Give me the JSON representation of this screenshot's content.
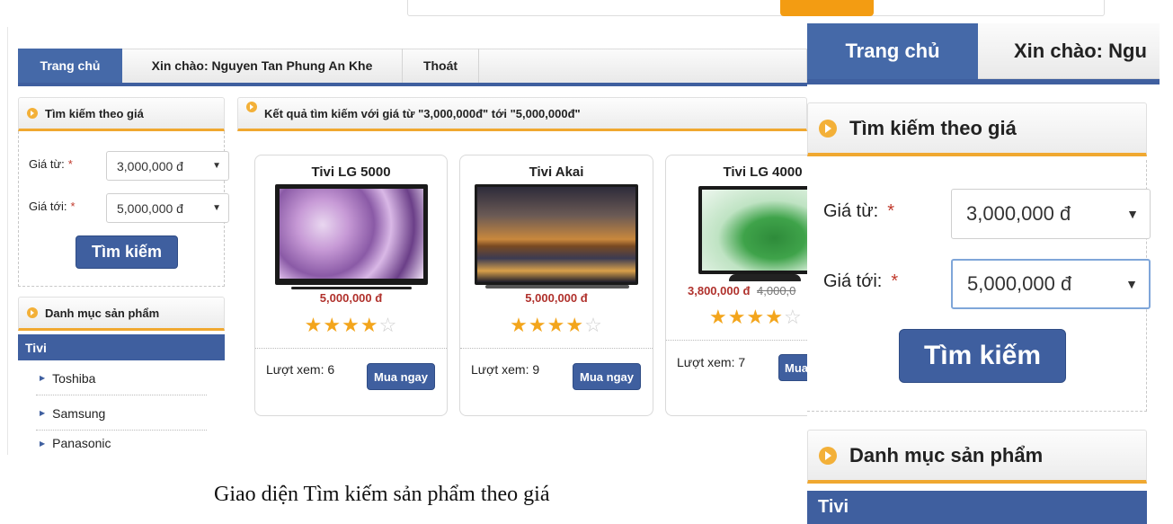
{
  "nav": {
    "home": "Trang chủ",
    "greeting": "Xin chào: Nguyen Tan Phung An Khe",
    "logout": "Thoát"
  },
  "price_search": {
    "header": "Tìm kiếm theo giá",
    "from_label": "Giá từ:",
    "to_label": "Giá tới:",
    "required_mark": "*",
    "from_value": "3,000,000 đ",
    "to_value": "5,000,000 đ",
    "search_button": "Tìm kiếm"
  },
  "category": {
    "header": "Danh mục sản phẩm",
    "active": "Tivi",
    "items": [
      "Toshiba",
      "Samsung",
      "Panasonic"
    ]
  },
  "results": {
    "header": "Kết quả tìm kiếm với giá từ \"3,000,000đ\" tới \"5,000,000đ\"",
    "products": [
      {
        "name": "Tivi LG 5000",
        "price": "5,000,000 đ",
        "old_price": "",
        "rating": 4,
        "views_label": "Lượt xem: 6",
        "buy_label": "Mua ngay"
      },
      {
        "name": "Tivi Akai",
        "price": "5,000,000 đ",
        "old_price": "",
        "rating": 4,
        "views_label": "Lượt xem: 9",
        "buy_label": "Mua ngay"
      },
      {
        "name": "Tivi LG 4000",
        "price": "3,800,000 đ",
        "old_price": "4,000,0",
        "rating": 4,
        "views_label": "Lượt xem: 7",
        "buy_label": "Mua"
      }
    ]
  },
  "zoom": {
    "home": "Trang chủ",
    "greeting": "Xin chào: Ngu",
    "price_header": "Tìm kiếm theo giá",
    "from_label": "Giá từ:",
    "to_label": "Giá tới:",
    "required_mark": "*",
    "from_value": "3,000,000 đ",
    "to_value": "5,000,000 đ",
    "search_button": "Tìm kiếm",
    "category_header": "Danh mục sản phẩm",
    "category_active": "Tivi"
  },
  "caption": "Giao diện Tìm kiếm sản phẩm theo giá",
  "colors": {
    "primary": "#3f5f9f",
    "accent": "#f0a830",
    "price": "#b0312c",
    "star": "#f3a51c"
  }
}
